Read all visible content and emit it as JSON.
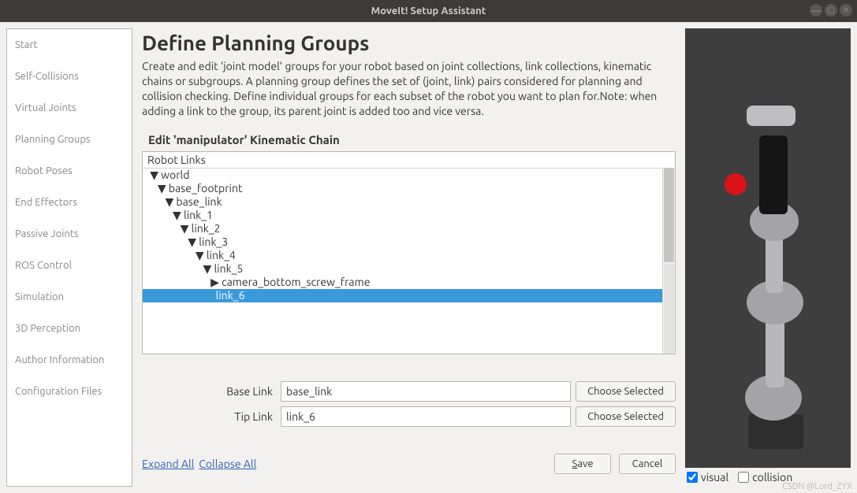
{
  "titlebar": {
    "title": "MoveIt! Setup Assistant"
  },
  "sidebar": {
    "items": [
      {
        "label": "Start"
      },
      {
        "label": "Self-Collisions"
      },
      {
        "label": "Virtual Joints"
      },
      {
        "label": "Planning Groups"
      },
      {
        "label": "Robot Poses"
      },
      {
        "label": "End Effectors"
      },
      {
        "label": "Passive Joints"
      },
      {
        "label": "ROS Control"
      },
      {
        "label": "Simulation"
      },
      {
        "label": "3D Perception"
      },
      {
        "label": "Author Information"
      },
      {
        "label": "Configuration Files"
      }
    ]
  },
  "main": {
    "title": "Define Planning Groups",
    "desc": "Create and edit 'joint model' groups for your robot based on joint collections, link collections, kinematic chains or subgroups. A planning group defines the set of (joint, link) pairs considered for planning and collision checking. Define individual groups for each subset of the robot you want to plan for.Note: when adding a link to the group, its parent joint is added too and vice versa.",
    "section_title": "Edit 'manipulator' Kinematic Chain",
    "tree_header": "Robot Links",
    "tree": [
      {
        "indent": 0,
        "arrow": "▼",
        "label": "world",
        "selected": false
      },
      {
        "indent": 1,
        "arrow": "▼",
        "label": "base_footprint",
        "selected": false
      },
      {
        "indent": 2,
        "arrow": "▼",
        "label": "base_link",
        "selected": false
      },
      {
        "indent": 3,
        "arrow": "▼",
        "label": "link_1",
        "selected": false
      },
      {
        "indent": 4,
        "arrow": "▼",
        "label": "link_2",
        "selected": false
      },
      {
        "indent": 5,
        "arrow": "▼",
        "label": "link_3",
        "selected": false
      },
      {
        "indent": 6,
        "arrow": "▼",
        "label": "link_4",
        "selected": false
      },
      {
        "indent": 7,
        "arrow": "▼",
        "label": "link_5",
        "selected": false
      },
      {
        "indent": 8,
        "arrow": "▶",
        "label": "camera_bottom_screw_frame",
        "selected": false
      },
      {
        "indent": 8,
        "arrow": " ",
        "label": "link_6",
        "selected": true
      }
    ],
    "base_link_label": "Base Link",
    "base_link_value": "base_link",
    "tip_link_label": "Tip Link",
    "tip_link_value": "link_6",
    "choose_selected": "Choose Selected",
    "expand_all": "Expand All",
    "collapse_all": "Collapse All",
    "save": "Save",
    "cancel": "Cancel"
  },
  "viz": {
    "visual_label": "visual",
    "visual_checked": true,
    "collision_label": "collision",
    "collision_checked": false
  },
  "watermark": "CSDN @Lord_ZYX"
}
